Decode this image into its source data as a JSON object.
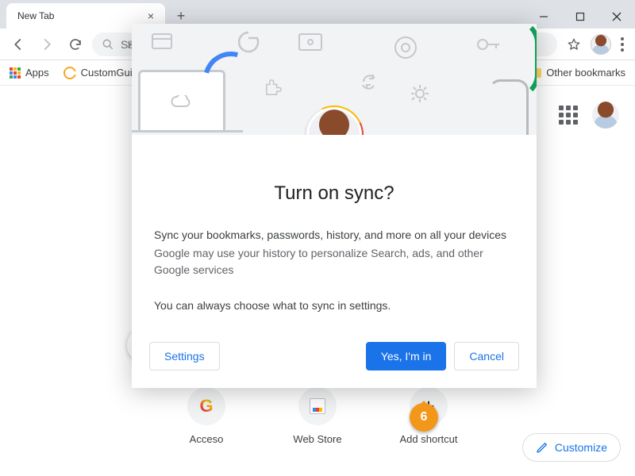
{
  "window": {
    "tab_title": "New Tab"
  },
  "toolbar": {
    "omnibox_placeholder": "Search Google or type a URL",
    "omnibox_display": "Sea"
  },
  "bookmarks": {
    "apps": "Apps",
    "customguide": "CustomGuide",
    "other": "Other bookmarks"
  },
  "ntp": {
    "shortcuts": [
      {
        "label": "Acceso"
      },
      {
        "label": "Web Store"
      },
      {
        "label": "Add shortcut"
      }
    ],
    "customize": "Customize"
  },
  "dialog": {
    "title": "Turn on sync?",
    "line1": "Sync your bookmarks, passwords, history, and more on all your devices",
    "line2": "Google may use your history to personalize Search, ads, and other Google services",
    "note": "You can always choose what to sync in settings.",
    "settings": "Settings",
    "yes": "Yes, I'm in",
    "cancel": "Cancel"
  },
  "callout": {
    "number": "6"
  }
}
